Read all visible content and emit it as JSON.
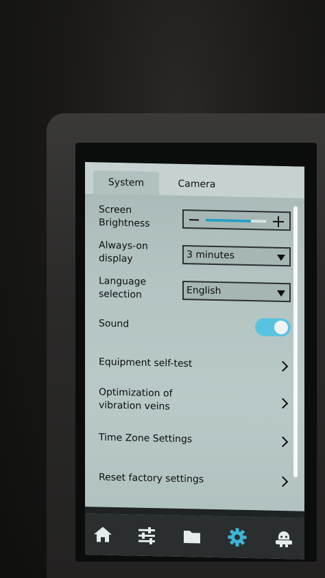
{
  "tabs": [
    {
      "label": "System",
      "active": true
    },
    {
      "label": "Camera",
      "active": false
    }
  ],
  "settings": {
    "brightness": {
      "label_line1": "Screen",
      "label_line2": "Brightness",
      "level": 0.75
    },
    "always_on": {
      "label_line1": "Always-on",
      "label_line2": "display",
      "value": "3 minutes"
    },
    "language": {
      "label_line1": "Language",
      "label_line2": "selection",
      "value": "English"
    },
    "sound": {
      "label": "Sound",
      "enabled": true
    },
    "self_test": {
      "label": "Equipment self-test"
    },
    "vibration": {
      "label_line1": "Optimization of",
      "label_line2": "vibration veins"
    },
    "time_zone": {
      "label": "Time Zone Settings"
    },
    "reset": {
      "label": "Reset factory settings"
    }
  },
  "navbar": {
    "items": [
      {
        "icon": "home-icon"
      },
      {
        "icon": "sliders-icon"
      },
      {
        "icon": "folder-icon"
      },
      {
        "icon": "gear-icon",
        "active": true
      },
      {
        "icon": "robot-icon"
      }
    ]
  },
  "colors": {
    "accent": "#2a9fbe",
    "toggle_on": "#58c3e0",
    "screen_bg": "#b3c4c3",
    "navbar_bg": "#2a2e2e"
  }
}
